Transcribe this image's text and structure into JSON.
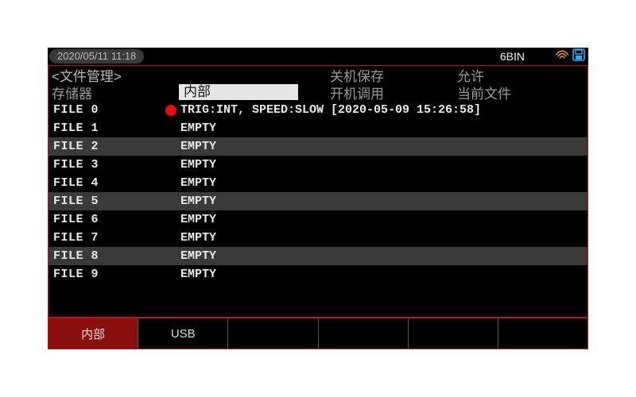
{
  "status": {
    "datetime": "2020/05/11 11:18",
    "mode": "6BIN"
  },
  "header": {
    "title": "<文件管理>",
    "shutdown_save_label": "关机保存",
    "shutdown_save_value": "允许",
    "storage_label": "存储器",
    "storage_value": "内部",
    "boot_recall_label": "开机调用",
    "boot_recall_value": "当前文件"
  },
  "files": [
    {
      "name": "FILE 0",
      "active": true,
      "desc": "TRIG:INT, SPEED:SLOW [2020-05-09 15:26:58]"
    },
    {
      "name": "FILE 1",
      "active": false,
      "desc": "EMPTY"
    },
    {
      "name": "FILE 2",
      "active": false,
      "desc": "EMPTY"
    },
    {
      "name": "FILE 3",
      "active": false,
      "desc": "EMPTY"
    },
    {
      "name": "FILE 4",
      "active": false,
      "desc": "EMPTY"
    },
    {
      "name": "FILE 5",
      "active": false,
      "desc": "EMPTY"
    },
    {
      "name": "FILE 6",
      "active": false,
      "desc": "EMPTY"
    },
    {
      "name": "FILE 7",
      "active": false,
      "desc": "EMPTY"
    },
    {
      "name": "FILE 8",
      "active": false,
      "desc": "EMPTY"
    },
    {
      "name": "FILE 9",
      "active": false,
      "desc": "EMPTY"
    }
  ],
  "softkeys": [
    {
      "label": "内部",
      "active": true
    },
    {
      "label": "USB",
      "active": false
    },
    {
      "label": "",
      "active": false
    },
    {
      "label": "",
      "active": false
    },
    {
      "label": "",
      "active": false
    },
    {
      "label": "",
      "active": false
    }
  ]
}
